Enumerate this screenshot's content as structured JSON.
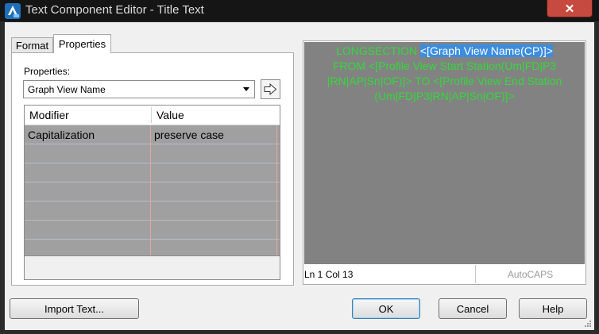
{
  "window": {
    "title": "Text Component Editor - Title Text",
    "close_glyph": "✕"
  },
  "tabs": [
    {
      "label": "Format",
      "active": false
    },
    {
      "label": "Properties",
      "active": true
    }
  ],
  "properties": {
    "label": "Properties:",
    "selected": "Graph View Name",
    "insert_icon": "arrow-right-icon"
  },
  "grid": {
    "headers": {
      "modifier": "Modifier",
      "value": "Value"
    },
    "rows": [
      {
        "modifier": "Capitalization",
        "value": "preserve case"
      },
      {
        "modifier": "",
        "value": ""
      },
      {
        "modifier": "",
        "value": ""
      },
      {
        "modifier": "",
        "value": ""
      },
      {
        "modifier": "",
        "value": ""
      },
      {
        "modifier": "",
        "value": ""
      },
      {
        "modifier": "",
        "value": ""
      }
    ]
  },
  "editor": {
    "line1_plain": "LONGSECTION ",
    "line1_selected": "<[Graph View Name(CP)]>",
    "line2": "FROM <[Profile View Start Station(Um|FD|P3",
    "line3": "|RN|AP|Sn|OF)]> TO <[Profile View End Station",
    "line4": "(Um|FD|P3|RN|AP|Sn|OF)]>",
    "text_color": "#33d93a",
    "background_color": "#828282",
    "status_position": "Ln 1 Col 13",
    "status_caps": "AutoCAPS"
  },
  "buttons": {
    "import": "Import Text...",
    "ok": "OK",
    "cancel": "Cancel",
    "help": "Help"
  }
}
